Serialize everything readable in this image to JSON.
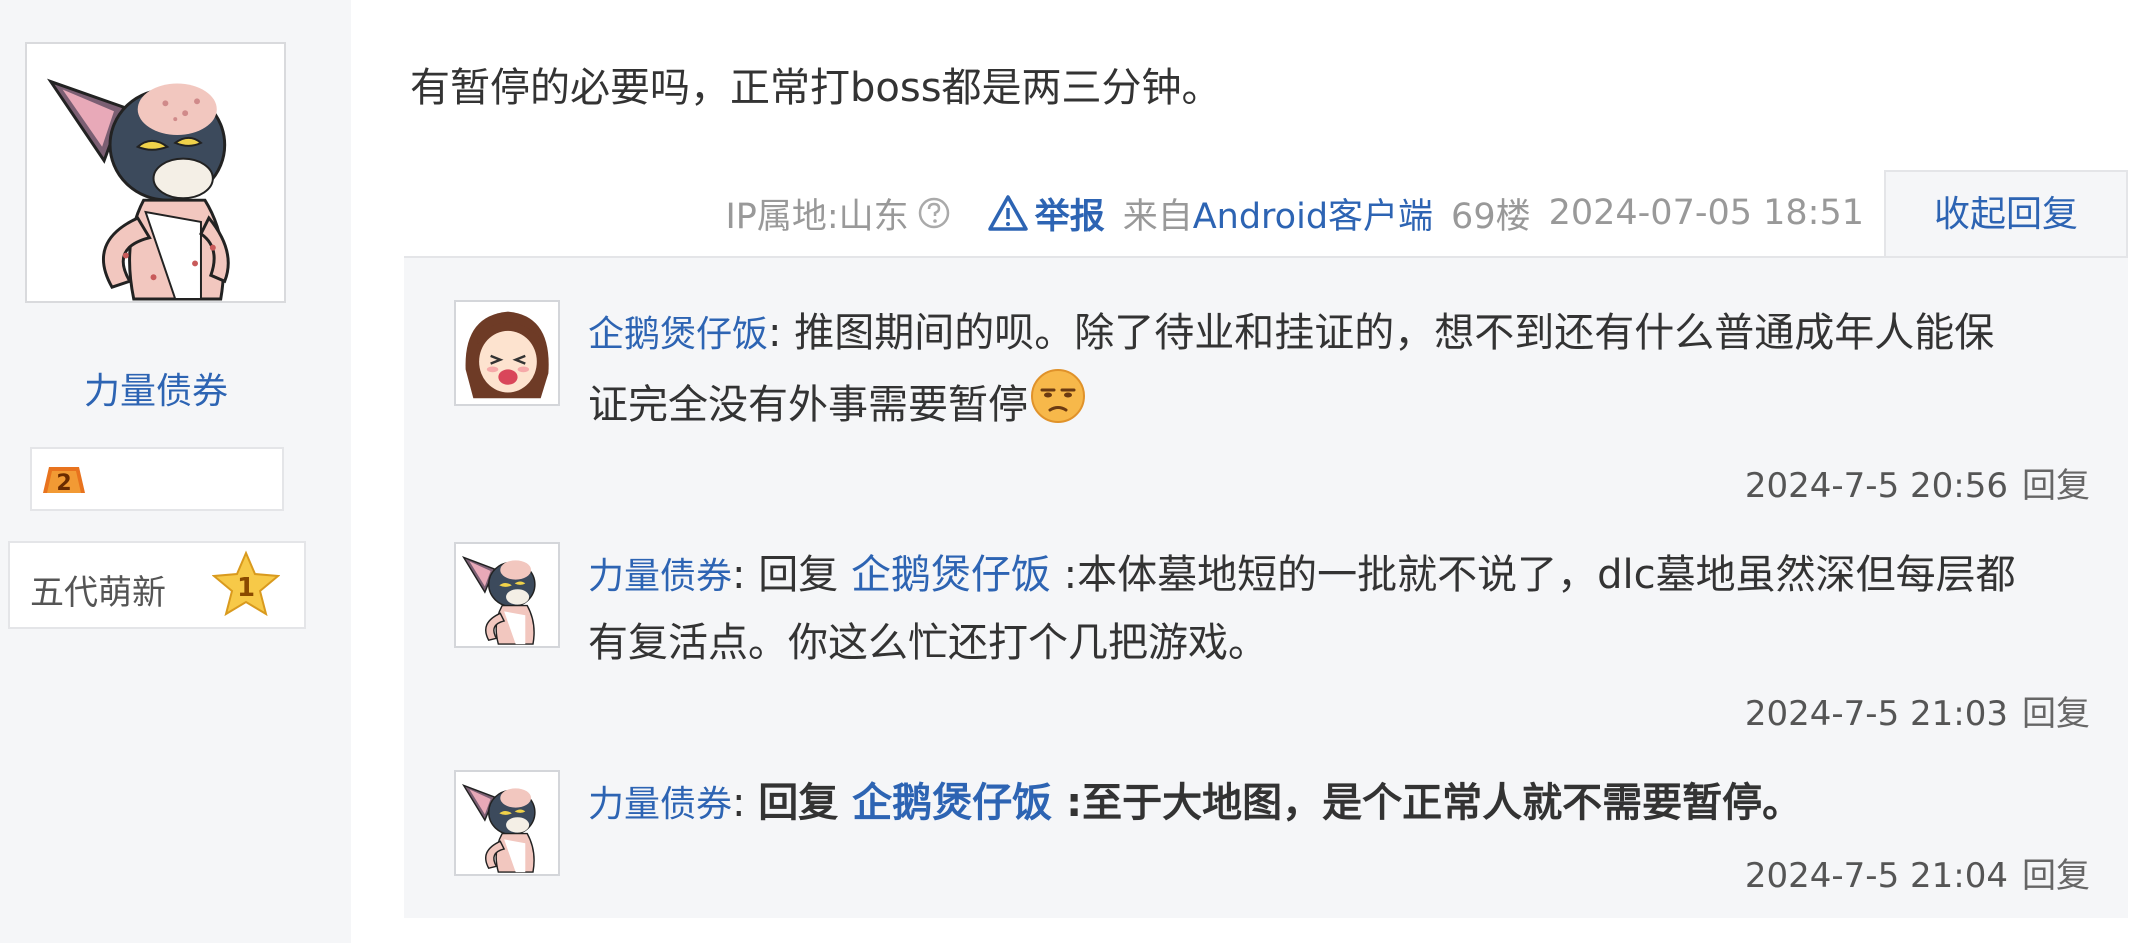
{
  "author": {
    "name": "力量债券",
    "badge_text": "五代萌新",
    "level_number": "2",
    "star_number": "1"
  },
  "post": {
    "content": "有暂停的必要吗，正常打boss都是两三分钟。",
    "ip_label": "IP属地:山东",
    "report_label": "举报",
    "client_prefix": "来自",
    "client_name": "Android客户端",
    "floor": "69楼",
    "timestamp": "2024-07-05 18:51",
    "collapse_label": "收起回复"
  },
  "replies": [
    {
      "name": "企鹅煲仔饭",
      "separator": ": ",
      "content": "推图期间的呗。除了待业和挂证的，想不到还有什么普通成年人能保证完全没有外事需要暂停",
      "emoji": "unamused-face-icon",
      "time": "2024-7-5 20:56",
      "reply_label": "回复"
    },
    {
      "name": "力量债券",
      "separator": ": ",
      "reply_prefix": "回复 ",
      "target": "企鹅煲仔饭",
      "content": " :本体墓地短的一批就不说了，dlc墓地虽然深但每层都有复活点。你这么忙还打个几把游戏。",
      "time": "2024-7-5 21:03",
      "reply_label": "回复"
    },
    {
      "name": "力量债券",
      "separator": ": ",
      "reply_prefix": "回复 ",
      "target": "企鹅煲仔饭",
      "content": " :至于大地图，是个正常人就不需要暂停。",
      "time": "2024-7-5 21:04",
      "reply_label": "回复"
    }
  ],
  "colors": {
    "link": "#2d64b3",
    "muted": "#999999",
    "panel": "#f5f6f8"
  }
}
